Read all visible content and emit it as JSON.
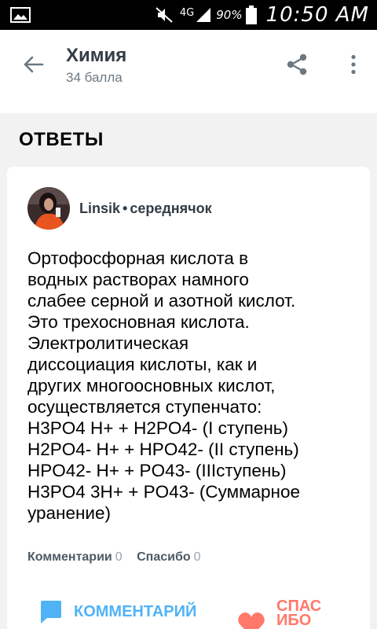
{
  "status_bar": {
    "network": "4G",
    "battery_percent": "90%",
    "time": "10:50 AM",
    "icons": [
      "gallery-icon",
      "mute-icon",
      "signal-icon",
      "battery-icon"
    ]
  },
  "header": {
    "title": "Химия",
    "points": "34 балла",
    "icons": [
      "back-arrow-icon",
      "share-icon",
      "more-vertical-icon"
    ]
  },
  "section": {
    "title": "ОТВЕТЫ"
  },
  "answer": {
    "author": {
      "name": "Linsik",
      "separator": "•",
      "rank": "середнячок"
    },
    "lines": [
      "Ортофосфорная кислота в",
      "водных растворах намного",
      "слабее серной и азотной кислот.",
      "Это трехосновная кислота.",
      "Электролитическая",
      "диссоциация кислоты, как и",
      "других многоосновных кислот,",
      "осуществляется ступенчато:",
      "H3PO4 H+ + H2PO4- (I ступень)",
      "H2PO4- H+ + HPO42- (II ступень)",
      "HPO42- H+ + PO43- (IIIступень)",
      "H3PO4 3H+ + PO43- (Суммарное",
      "уранение)"
    ],
    "comments_label": "Комментарии",
    "comments_count": "0",
    "thanks_label": "Спасибо",
    "thanks_count": "0"
  },
  "actions": {
    "comment_button": "КОММЕНТАРИЙ",
    "thanks_button": "СПАСИБО"
  },
  "colors": {
    "accent_blue": "#4fb3f6",
    "accent_red": "#ff796b",
    "background": "#f2f2f2"
  }
}
